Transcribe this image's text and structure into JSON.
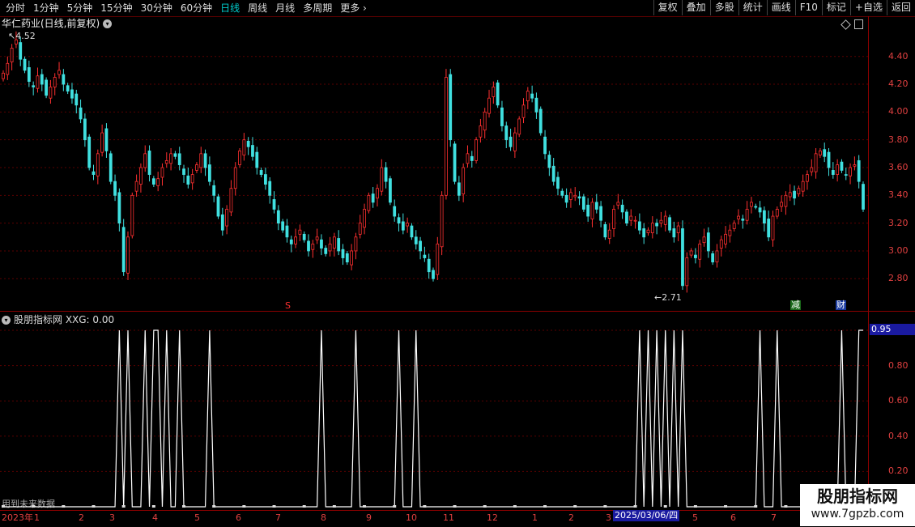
{
  "toolbar": {
    "periods": [
      "分时",
      "1分钟",
      "5分钟",
      "15分钟",
      "30分钟",
      "60分钟",
      "日线",
      "周线",
      "月线",
      "多周期",
      "更多"
    ],
    "active_period": "日线",
    "more_icon": "chevron-right-icon",
    "right_buttons": [
      "复权",
      "叠加",
      "多股",
      "统计",
      "画线",
      "F10",
      "标记",
      "+自选",
      "返回"
    ]
  },
  "main_panel": {
    "title": "华仁药业(日线,前复权)",
    "high_label": "4.52",
    "low_label": "2.71",
    "y_ticks": [
      "4.40",
      "4.20",
      "4.00",
      "3.80",
      "3.60",
      "3.40",
      "3.20",
      "3.00",
      "2.80"
    ],
    "tags": {
      "s": "S",
      "reduce": "减",
      "finance": "财"
    }
  },
  "indicator_panel": {
    "title": "股朋指标网 XXG: 0.00",
    "current_value": "0.95",
    "y_ticks": [
      "0.80",
      "0.60",
      "0.40",
      "0.20"
    ],
    "future_note": "用到未来数据"
  },
  "x_axis": {
    "labels": [
      "2023年",
      "1",
      "2",
      "3",
      "4",
      "5",
      "6",
      "7",
      "8",
      "9",
      "10",
      "11",
      "12",
      "1",
      "2",
      "3",
      "4",
      "5",
      "6",
      "7"
    ],
    "highlight": "2025/03/06/四"
  },
  "watermark": {
    "line1": "股朋指标网",
    "line2": "www.7gpzb.com"
  },
  "colors": {
    "up": "#ff3030",
    "down": "#40e0e0",
    "signal": "#ffffff",
    "axis": "#8b0000",
    "dashed": "#5a0000",
    "highlight": "#1a1aa0"
  },
  "chart_data": {
    "type": "candlestick",
    "price_range": [
      2.65,
      4.55
    ],
    "closes": [
      4.28,
      4.35,
      4.46,
      4.52,
      4.38,
      4.3,
      4.22,
      4.18,
      4.26,
      4.2,
      4.12,
      4.18,
      4.25,
      4.3,
      4.2,
      4.15,
      4.1,
      4.05,
      3.95,
      3.8,
      3.6,
      3.55,
      3.7,
      3.85,
      3.72,
      3.5,
      3.4,
      3.2,
      2.85,
      3.1,
      3.4,
      3.5,
      3.6,
      3.7,
      3.55,
      3.48,
      3.52,
      3.6,
      3.65,
      3.7,
      3.68,
      3.62,
      3.55,
      3.48,
      3.55,
      3.62,
      3.7,
      3.6,
      3.5,
      3.4,
      3.25,
      3.15,
      3.3,
      3.45,
      3.6,
      3.72,
      3.8,
      3.75,
      3.68,
      3.6,
      3.55,
      3.48,
      3.4,
      3.3,
      3.2,
      3.15,
      3.1,
      3.05,
      3.1,
      3.15,
      3.08,
      3.0,
      3.05,
      3.1,
      3.02,
      2.98,
      3.05,
      3.1,
      3.0,
      2.95,
      2.92,
      3.0,
      3.1,
      3.2,
      3.3,
      3.4,
      3.35,
      3.45,
      3.6,
      3.5,
      3.35,
      3.25,
      3.2,
      3.15,
      3.2,
      3.1,
      3.05,
      3.0,
      2.95,
      2.85,
      2.8,
      3.05,
      3.4,
      4.25,
      3.8,
      3.5,
      3.4,
      3.6,
      3.7,
      3.65,
      3.8,
      3.9,
      4.0,
      4.1,
      4.18,
      4.05,
      3.9,
      3.8,
      3.75,
      3.85,
      3.95,
      4.05,
      4.15,
      4.1,
      4.0,
      3.85,
      3.7,
      3.6,
      3.5,
      3.45,
      3.4,
      3.35,
      3.42,
      3.4,
      3.38,
      3.3,
      3.25,
      3.35,
      3.3,
      3.22,
      3.1,
      3.15,
      3.3,
      3.35,
      3.28,
      3.2,
      3.25,
      3.22,
      3.15,
      3.1,
      3.15,
      3.2,
      3.18,
      3.22,
      3.25,
      3.15,
      3.1,
      3.18,
      2.75,
      2.95,
      3.0,
      2.95,
      3.05,
      3.1,
      3.0,
      2.92,
      3.0,
      3.08,
      3.12,
      3.15,
      3.2,
      3.25,
      3.22,
      3.3,
      3.35,
      3.32,
      3.28,
      3.2,
      3.1,
      3.25,
      3.3,
      3.35,
      3.4,
      3.42,
      3.38,
      3.45,
      3.5,
      3.55,
      3.6,
      3.7,
      3.72,
      3.68,
      3.6,
      3.55,
      3.62,
      3.58,
      3.55,
      3.6,
      3.62,
      3.5,
      3.3
    ],
    "xxg_signal_bars": [
      27,
      29,
      33,
      35,
      36,
      38,
      41,
      48,
      74,
      82,
      92,
      96,
      148,
      150,
      152,
      154,
      156,
      158,
      176,
      180,
      195,
      199,
      200
    ]
  }
}
